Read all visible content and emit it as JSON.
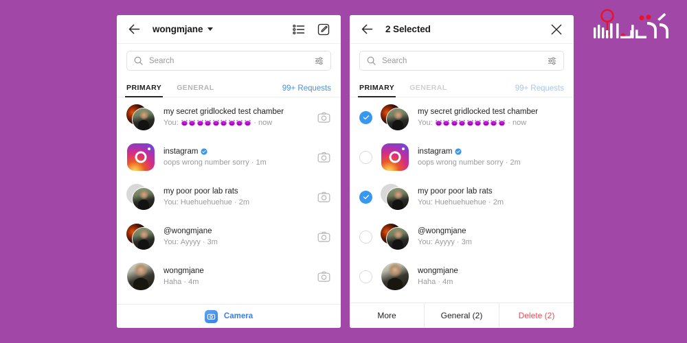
{
  "background_color": "#a047a8",
  "watermark": {
    "name": "aksbazaar-logo",
    "text": "آکس بازار",
    "accent_color": "#e8142d"
  },
  "left_panel": {
    "header": {
      "back_icon": "back-arrow-icon",
      "title": "wongmjane",
      "chevron": "chevron-down-icon",
      "list_icon": "bullet-list-icon",
      "compose_icon": "compose-pencil-icon"
    },
    "search": {
      "icon": "search-icon",
      "placeholder": "Search",
      "filter_icon": "filter-sliders-icon"
    },
    "tabs": {
      "primary": "PRIMARY",
      "general": "GENERAL",
      "requests": "99+ Requests",
      "active": "PRIMARY"
    },
    "threads": [
      {
        "title": "my secret gridlocked test chamber",
        "prefix": "You:",
        "emoji_count": 9,
        "emoji": "purple-devil-face",
        "time": "now",
        "avatar": "group-photo",
        "verified": false
      },
      {
        "title": "instagram",
        "prefix": "",
        "preview": "oops wrong number sorry",
        "time": "1m",
        "avatar": "instagram-logo",
        "verified": true
      },
      {
        "title": "my poor poor lab rats",
        "prefix": "You:",
        "preview": "Huehuehuehue",
        "time": "2m",
        "avatar": "group-gray-photo",
        "verified": false
      },
      {
        "title": "@wongmjane",
        "prefix": "You:",
        "preview": "Ayyyy",
        "time": "3m",
        "avatar": "group-photo",
        "verified": false
      },
      {
        "title": "wongmjane",
        "prefix": "",
        "preview": "Haha",
        "time": "4m",
        "avatar": "single-photo",
        "verified": false
      }
    ],
    "thread_action_icon": "camera-outline-icon",
    "bottom_bar": {
      "icon": "camera-icon",
      "label": "Camera",
      "color": "#3b7fe8"
    }
  },
  "right_panel": {
    "header": {
      "back_icon": "back-arrow-icon",
      "title": "2 Selected",
      "close_icon": "close-x-icon"
    },
    "search": {
      "icon": "search-icon",
      "placeholder": "Search",
      "filter_icon": "filter-sliders-icon"
    },
    "tabs": {
      "primary": "PRIMARY",
      "general": "GENERAL",
      "requests": "99+ Requests",
      "active": "PRIMARY"
    },
    "threads": [
      {
        "selected": true,
        "title": "my secret gridlocked test chamber",
        "prefix": "You:",
        "emoji_count": 9,
        "emoji": "purple-devil-face",
        "time": "now",
        "avatar": "group-photo",
        "verified": false
      },
      {
        "selected": false,
        "title": "instagram",
        "prefix": "",
        "preview": "oops wrong number sorry",
        "time": "2m",
        "avatar": "instagram-logo",
        "verified": true
      },
      {
        "selected": true,
        "title": "my poor poor lab rats",
        "prefix": "You:",
        "preview": "Huehuehuehue",
        "time": "2m",
        "avatar": "group-gray-photo",
        "verified": false
      },
      {
        "selected": false,
        "title": "@wongmjane",
        "prefix": "You:",
        "preview": "Ayyyy",
        "time": "3m",
        "avatar": "group-photo",
        "verified": false
      },
      {
        "selected": false,
        "title": "wongmjane",
        "prefix": "",
        "preview": "Haha",
        "time": "4m",
        "avatar": "single-photo",
        "verified": false
      }
    ],
    "selection_color": "#3897f0",
    "bottom_bar": {
      "more": "More",
      "general": "General (2)",
      "delete": "Delete (2)",
      "delete_color": "#ed4956"
    }
  }
}
